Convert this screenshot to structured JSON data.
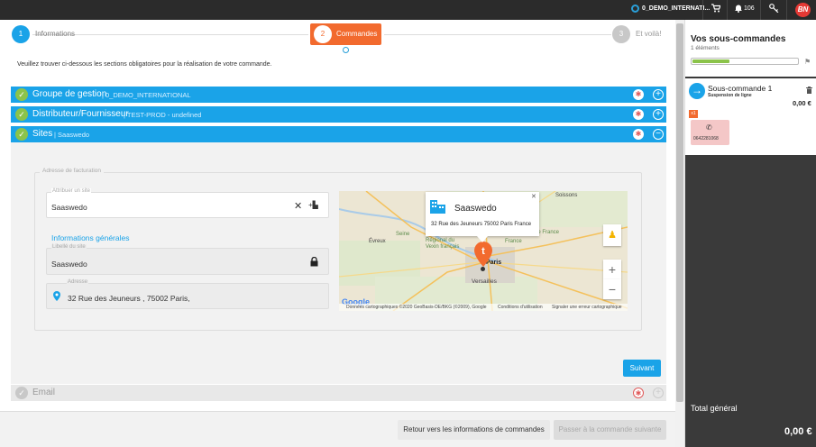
{
  "topbar": {
    "org_name": "0_DEMO_INTERNATI...",
    "notifications_count": "106",
    "logo_text": "BN"
  },
  "stepper": {
    "steps": [
      {
        "num": "1",
        "label": "Informations"
      },
      {
        "num": "2",
        "label": "Commandes"
      },
      {
        "num": "3",
        "label": "Et voilà!"
      }
    ]
  },
  "intro": "Veuillez trouver ci-dessous les sections obligatoires pour la réalisation de votre commande.",
  "sections": [
    {
      "title": "Groupe de gestion",
      "sub": "| 0_DEMO_INTERNATIONAL"
    },
    {
      "title": "Distributeur/Fournisseur",
      "sub": "| TEST-PROD - undefined"
    },
    {
      "title": "Sites",
      "sub": "| Saaswedo"
    },
    {
      "title": "Email",
      "sub": ""
    }
  ],
  "sites": {
    "legend": "Adresse de facturation",
    "assign_label": "Attribuer un site",
    "assign_value": "Saaswedo",
    "general_info": "Informations générales",
    "site_label": "Libellé du site",
    "site_value": "Saaswedo",
    "address_label": "Adresse",
    "address_value": "32 Rue des Jeuneurs , 75002 Paris,"
  },
  "map": {
    "popup_title": "Saaswedo",
    "popup_address": "32 Rue des Jeuneurs 75002 Paris France",
    "city_labels": [
      "Soissons",
      "Évreux",
      "Paris",
      "Versailles",
      "Seine",
      "Vexin français",
      "Régional du",
      "France",
      "Pays",
      "Pays de France"
    ],
    "attribution": "Données cartographiques ©2020 GeoBasis-DE/BKG (©2009), Google",
    "terms": "Conditions d'utilisation",
    "report": "Signaler une erreur cartographique",
    "google": "Google"
  },
  "buttons": {
    "suivant": "Suivant",
    "back": "Retour vers les informations de commandes",
    "next": "Passer à la commande suivante"
  },
  "right_panel": {
    "title": "Vos sous-commandes",
    "count": "1 éléments",
    "progress": 0.35,
    "subcommand": {
      "name": "Sous-commande 1",
      "sub": "Suspension de ligne",
      "price": "0,00 €",
      "badge": "x1",
      "phone": "0642281068"
    },
    "total_label": "Total général",
    "total_value": "0,00 €"
  },
  "colors": {
    "accent": "#1aa3e8",
    "active_step": "#f26a2e",
    "success": "#8bc34a"
  }
}
